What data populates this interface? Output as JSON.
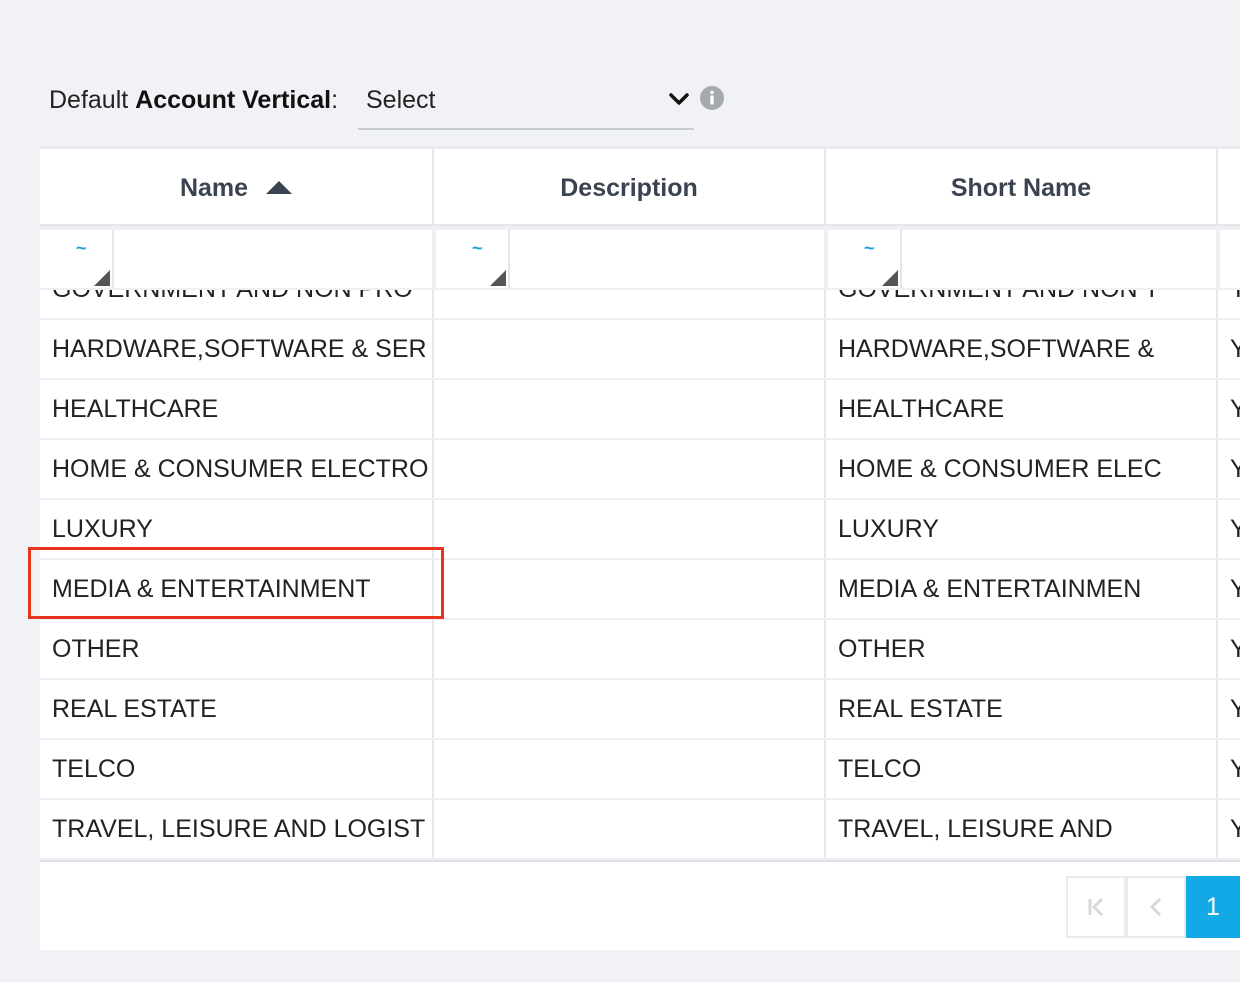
{
  "toolbar": {
    "label_prefix": "Default ",
    "label_bold": "Account Vertical",
    "label_suffix": ":",
    "select_value": "Select",
    "chevron_icon": "chevron-down-icon",
    "info_icon": "info-icon"
  },
  "grid": {
    "columns": [
      {
        "label": "Name",
        "sorted": "ascending"
      },
      {
        "label": "Description"
      },
      {
        "label": "Short Name"
      }
    ],
    "filter_operator_symbol": "~",
    "rows": [
      {
        "name": "GOVERNMENT AND NON PRO",
        "description": "",
        "short_name": "GOVERNMENT AND NON T",
        "flag": "Y"
      },
      {
        "name": "HARDWARE,SOFTWARE & SER",
        "description": "",
        "short_name": "HARDWARE,SOFTWARE &",
        "flag": "Y"
      },
      {
        "name": "HEALTHCARE",
        "description": "",
        "short_name": "HEALTHCARE",
        "flag": "Y"
      },
      {
        "name": "HOME & CONSUMER ELECTRO",
        "description": "",
        "short_name": "HOME & CONSUMER ELEC",
        "flag": "Y"
      },
      {
        "name": "LUXURY",
        "description": "",
        "short_name": "LUXURY",
        "flag": "Y"
      },
      {
        "name": "MEDIA & ENTERTAINMENT",
        "description": "",
        "short_name": "MEDIA & ENTERTAINMEN",
        "flag": "Y"
      },
      {
        "name": "OTHER",
        "description": "",
        "short_name": "OTHER",
        "flag": "Y"
      },
      {
        "name": "REAL ESTATE",
        "description": "",
        "short_name": "REAL ESTATE",
        "flag": "Y"
      },
      {
        "name": "TELCO",
        "description": "",
        "short_name": "TELCO",
        "flag": "Y"
      },
      {
        "name": "TRAVEL, LEISURE AND LOGIST",
        "description": "",
        "short_name": "TRAVEL, LEISURE AND",
        "flag": "Y"
      }
    ],
    "highlighted_row": "MEDIA & ENTERTAINMENT",
    "highlight_color": "#e8331f"
  },
  "pager": {
    "first_icon": "first-page-icon",
    "prev_icon": "prev-page-icon",
    "current_page": "1",
    "active_color": "#13a9e6"
  }
}
